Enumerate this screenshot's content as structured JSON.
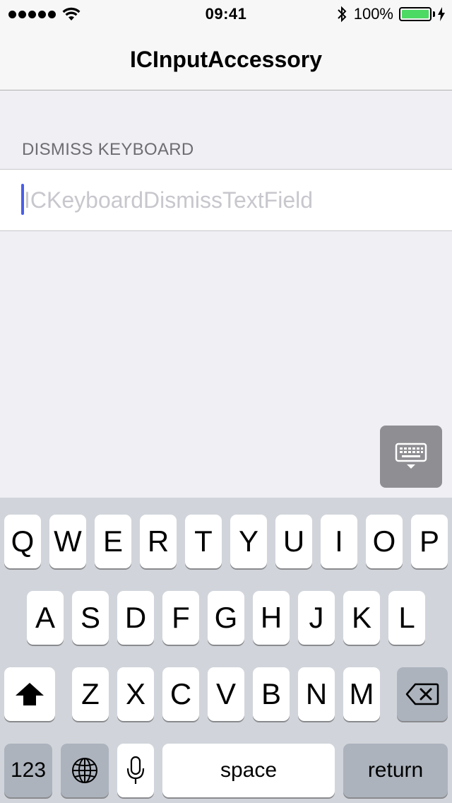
{
  "status_bar": {
    "time": "09:41",
    "battery_percent": "100%",
    "signal_dots": 5,
    "battery_level": 1.0,
    "battery_color": "#4cd964"
  },
  "nav": {
    "title": "ICInputAccessory"
  },
  "section": {
    "header": "DISMISS KEYBOARD"
  },
  "text_field": {
    "placeholder": "ICKeyboardDismissTextField",
    "value": ""
  },
  "accessory": {
    "dismiss_icon": "keyboard-dismiss-icon"
  },
  "keyboard": {
    "row1": [
      "Q",
      "W",
      "E",
      "R",
      "T",
      "Y",
      "U",
      "I",
      "O",
      "P"
    ],
    "row2": [
      "A",
      "S",
      "D",
      "F",
      "G",
      "H",
      "J",
      "K",
      "L"
    ],
    "row3": [
      "Z",
      "X",
      "C",
      "V",
      "B",
      "N",
      "M"
    ],
    "numbers_label": "123",
    "space_label": "space",
    "return_label": "return",
    "icons": {
      "shift": "shift-icon",
      "delete": "delete-icon",
      "globe": "globe-icon",
      "mic": "microphone-icon"
    }
  },
  "colors": {
    "background": "#efeff4",
    "caret": "#4a5fe8",
    "keyboard_bg": "#d1d5db",
    "dark_key": "#acb3bd"
  }
}
